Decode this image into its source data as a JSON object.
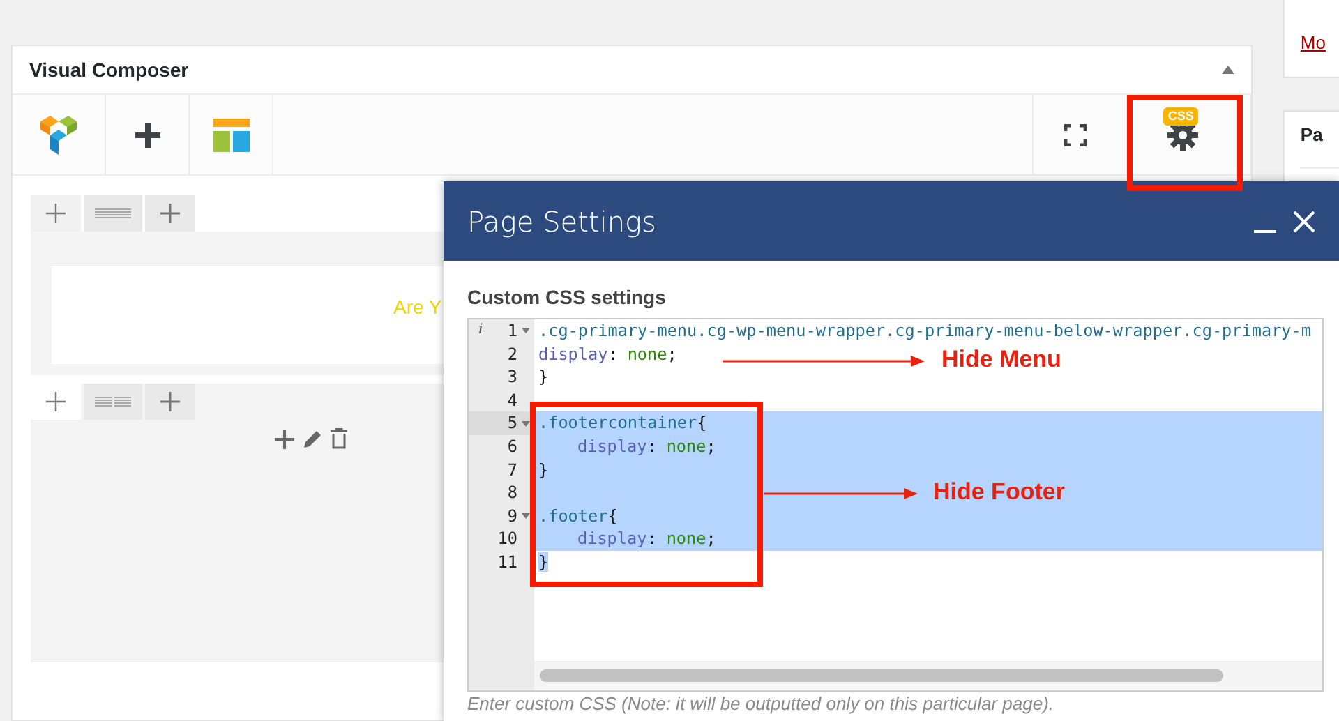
{
  "sidebar": [
    {
      "kind": "link",
      "text": "Mo"
    },
    {
      "kind": "heading",
      "text": "Pa"
    }
  ],
  "panel": {
    "title": "Visual Composer",
    "settings_badge": "CSS",
    "content_lines": [
      "Are Y"
    ]
  },
  "modal": {
    "title": "Page Settings",
    "section_label": "Custom CSS settings",
    "editor": {
      "lines": [
        {
          "number": "1",
          "marker": "i",
          "foldable": true,
          "active": false,
          "selected": false,
          "indented": false,
          "tokens": [
            {
              "kind": "selector",
              "text": ".cg-primary-menu.cg-wp-menu-wrapper.cg-primary-menu-below-wrapper.cg-primary-m"
            }
          ]
        },
        {
          "number": "2",
          "foldable": false,
          "active": false,
          "selected": false,
          "indented": false,
          "tokens": [
            {
              "kind": "property",
              "text": "display"
            },
            {
              "kind": "punct",
              "text": ":"
            },
            {
              "kind": "value",
              "text": "none"
            },
            {
              "kind": "punct",
              "text": ";"
            }
          ]
        },
        {
          "number": "3",
          "foldable": false,
          "active": false,
          "selected": false,
          "indented": false,
          "tokens": [
            {
              "kind": "punct",
              "text": "}"
            }
          ]
        },
        {
          "number": "4",
          "foldable": false,
          "active": false,
          "selected": false
        },
        {
          "number": "5",
          "foldable": true,
          "active": true,
          "selected": true,
          "indented": false,
          "tokens": [
            {
              "kind": "selector",
              "text": ".footercontainer"
            },
            {
              "kind": "punct",
              "text": "{"
            }
          ]
        },
        {
          "number": "6",
          "foldable": false,
          "active": false,
          "selected": true,
          "indented": true,
          "tokens": [
            {
              "kind": "property",
              "text": "display"
            },
            {
              "kind": "punct",
              "text": ":"
            },
            {
              "kind": "value",
              "text": "none"
            },
            {
              "kind": "punct",
              "text": ";"
            }
          ]
        },
        {
          "number": "7",
          "foldable": false,
          "active": false,
          "selected": true,
          "indented": false,
          "tokens": [
            {
              "kind": "punct",
              "text": "}"
            }
          ]
        },
        {
          "number": "8",
          "foldable": false,
          "active": false,
          "selected": true
        },
        {
          "number": "9",
          "foldable": true,
          "active": false,
          "selected": true,
          "indented": false,
          "tokens": [
            {
              "kind": "selector",
              "text": ".footer"
            },
            {
              "kind": "punct",
              "text": "{"
            }
          ]
        },
        {
          "number": "10",
          "foldable": false,
          "active": false,
          "selected": true,
          "indented": true,
          "tokens": [
            {
              "kind": "property",
              "text": "display"
            },
            {
              "kind": "punct",
              "text": ":"
            },
            {
              "kind": "value",
              "text": "none"
            },
            {
              "kind": "punct",
              "text": ";"
            }
          ]
        },
        {
          "number": "11",
          "foldable": false,
          "active": false,
          "selected": true,
          "indented": false,
          "tokens": [
            {
              "kind": "punct",
              "text": "}"
            }
          ]
        }
      ]
    },
    "hint": "Enter custom CSS (Note: it will be outputted only on this particular page)."
  },
  "annotations": [
    {
      "label": "Hide Menu"
    },
    {
      "label": "Hide Footer"
    }
  ]
}
